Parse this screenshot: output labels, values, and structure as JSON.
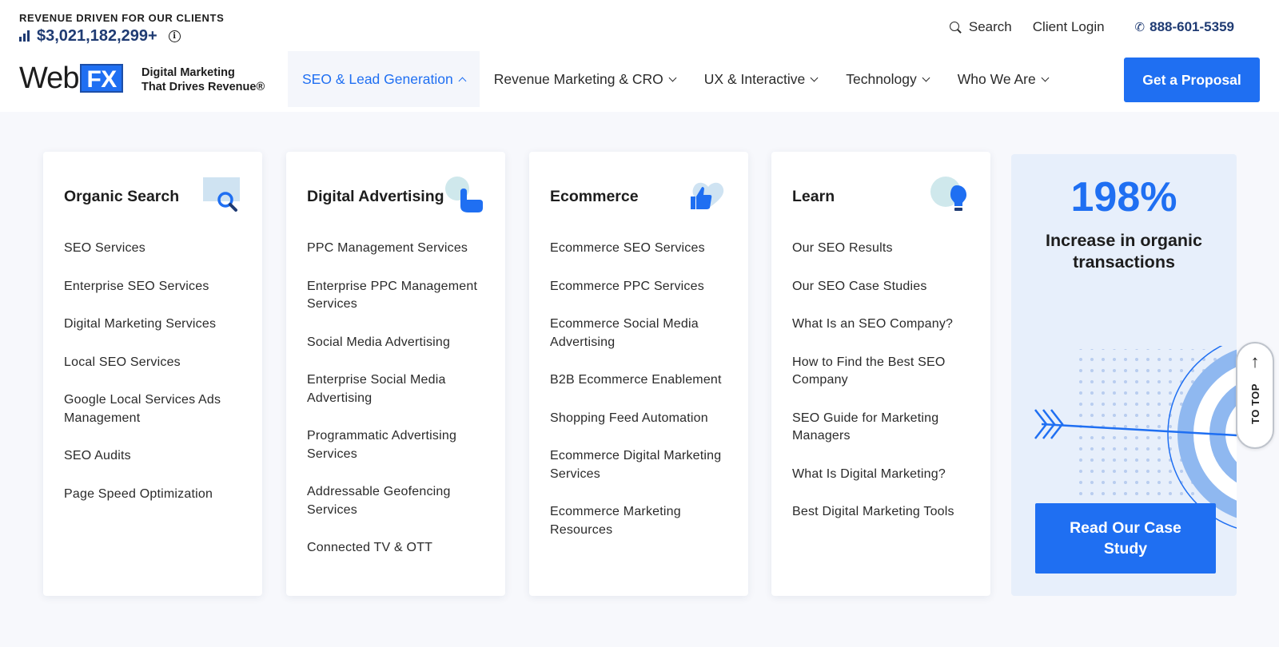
{
  "header": {
    "revenue_tagline": "REVENUE DRIVEN FOR OUR CLIENTS",
    "revenue_amount": "$3,021,182,299+",
    "logo_web": "Web",
    "logo_fx": "FX",
    "logo_tagline_line1": "Digital Marketing",
    "logo_tagline_line2": "That Drives Revenue®",
    "search_label": "Search",
    "client_login_label": "Client Login",
    "phone": "888-601-5359",
    "cta_label": "Get a Proposal"
  },
  "nav": {
    "items": [
      {
        "label": "SEO & Lead Generation",
        "state": "expanded"
      },
      {
        "label": "Revenue Marketing & CRO",
        "state": "collapsed"
      },
      {
        "label": "UX & Interactive",
        "state": "collapsed"
      },
      {
        "label": "Technology",
        "state": "collapsed"
      },
      {
        "label": "Who We Are",
        "state": "collapsed"
      }
    ]
  },
  "menu": {
    "columns": [
      {
        "title": "Organic Search",
        "icon": "magnifier-icon",
        "items": [
          "SEO Services",
          "Enterprise SEO Services",
          "Digital Marketing Services",
          "Local SEO Services",
          "Google Local Services Ads Management",
          "SEO Audits",
          "Page Speed Optimization"
        ]
      },
      {
        "title": "Digital Advertising",
        "icon": "pointer-click-icon",
        "items": [
          "PPC Management Services",
          "Enterprise PPC Management Services",
          "Social Media Advertising",
          "Enterprise Social Media Advertising",
          "Programmatic Advertising Services",
          "Addressable Geofencing Services",
          "Connected TV & OTT"
        ]
      },
      {
        "title": "Ecommerce",
        "icon": "thumbs-up-icon",
        "items": [
          "Ecommerce SEO Services",
          "Ecommerce PPC Services",
          "Ecommerce Social Media Advertising",
          "B2B Ecommerce Enablement",
          "Shopping Feed Automation",
          "Ecommerce Digital Marketing Services",
          "Ecommerce Marketing Resources"
        ]
      },
      {
        "title": "Learn",
        "icon": "lightbulb-icon",
        "items": [
          "Our SEO Results",
          "Our SEO Case Studies",
          "What Is an SEO Company?",
          "How to Find the Best SEO Company",
          "SEO Guide for Marketing Managers",
          "What Is Digital Marketing?",
          "Best Digital Marketing Tools"
        ]
      }
    ],
    "promo": {
      "stat": "198%",
      "text": "Increase in organic transactions",
      "button_label": "Read Our Case Study"
    }
  },
  "to_top": {
    "arrow": "↑",
    "label": "TO TOP"
  },
  "colors": {
    "brand_blue": "#1f6ff2",
    "navy": "#1f3b73",
    "promo_bg": "#e7effb"
  }
}
